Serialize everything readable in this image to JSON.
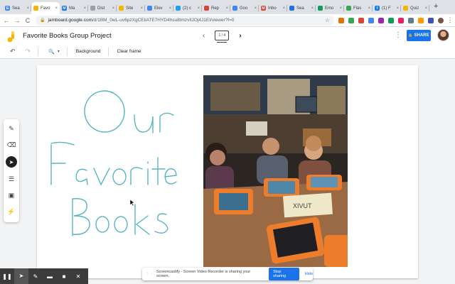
{
  "browser": {
    "tabs": [
      {
        "label": "Sea",
        "color": "#4285f4",
        "glyph": "G"
      },
      {
        "label": "Favo",
        "color": "#f4b400",
        "glyph": "",
        "active": true
      },
      {
        "label": "Ma",
        "color": "#1a73e8",
        "glyph": "M"
      },
      {
        "label": "Dist",
        "color": "#9aa0a6",
        "glyph": ""
      },
      {
        "label": "Site",
        "color": "#f4b400",
        "glyph": ""
      },
      {
        "label": "Elev",
        "color": "#4285f4",
        "glyph": ""
      },
      {
        "label": "(2) c",
        "color": "#1da1f2",
        "glyph": ""
      },
      {
        "label": "Rep",
        "color": "#db4437",
        "glyph": ""
      },
      {
        "label": "Goo",
        "color": "#4285f4",
        "glyph": ""
      },
      {
        "label": "Inbo",
        "color": "#db4437",
        "glyph": "M"
      },
      {
        "label": "Sea",
        "color": "#1a73e8",
        "glyph": ""
      },
      {
        "label": "Emo",
        "color": "#0f9d58",
        "glyph": ""
      },
      {
        "label": "Flas",
        "color": "#34a853",
        "glyph": ""
      },
      {
        "label": "(1) F",
        "color": "#1877f2",
        "glyph": "f"
      },
      {
        "label": "Quiz",
        "color": "#f4b400",
        "glyph": ""
      }
    ],
    "new_tab": "+",
    "back": "←",
    "forward": "→",
    "reload": "C",
    "url_host": "jamboard.google.com",
    "url_path": "/d/1BM_0wL-uv6pzXgCEliATE7HYD4hsu8tmzvIlJOj4J1EI/viewer?f=0",
    "star": "☆"
  },
  "app": {
    "title": "Favorite Books Group Project",
    "frame_indicator": "1 / 4",
    "prev": "‹",
    "next": "›",
    "more": "⋮",
    "share_label": "SHARE",
    "share_lock": "🔒"
  },
  "toolbar": {
    "undo": "↶",
    "redo": "↷",
    "zoom": "🔍",
    "zoom_caret": "▾",
    "background_label": "Background",
    "clear_label": "Clear frame"
  },
  "canvas": {
    "handwriting": [
      "Our",
      "Favorite",
      "Books"
    ],
    "photo_sign": "XIVUT"
  },
  "tools": {
    "pen": "✎",
    "eraser": "⌫",
    "select": "➤",
    "note": "☰",
    "image": "▣",
    "laser": "⚡"
  },
  "recorder": {
    "pause": "❚❚",
    "cursor": "➤",
    "pen": "✎",
    "highlighter": "▬",
    "camera": "■",
    "close": "✕"
  },
  "banner": {
    "grip": "⋮⋮",
    "message": "Screencastify - Screen Video Recorder is sharing your screen.",
    "stop_label": "Stop sharing",
    "hide_label": "Hide"
  }
}
